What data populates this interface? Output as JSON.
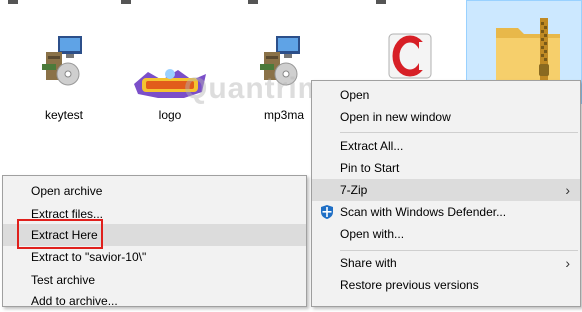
{
  "files": [
    {
      "label": "keytest",
      "icon": "installer-icon"
    },
    {
      "label": "logo",
      "icon": "everwing-logo-icon"
    },
    {
      "label": "mp3ma",
      "icon": "installer-icon"
    },
    {
      "label": "",
      "icon": "opera-icon"
    },
    {
      "label": "",
      "icon": "zip-folder-icon"
    }
  ],
  "watermark": "Quantrimang",
  "context_menu": {
    "items": [
      {
        "label": "Open"
      },
      {
        "label": "Open in new window"
      },
      {
        "label": "Extract All..."
      },
      {
        "label": "Pin to Start"
      },
      {
        "label": "7-Zip"
      },
      {
        "label": "Scan with Windows Defender..."
      },
      {
        "label": "Open with..."
      },
      {
        "label": "Share with"
      },
      {
        "label": "Restore previous versions"
      }
    ],
    "submenu_arrow": "›"
  },
  "zip_submenu": {
    "items": [
      {
        "label": "Open archive"
      },
      {
        "label": "Extract files..."
      },
      {
        "label": "Extract Here"
      },
      {
        "label": "Extract to \"savior-10\\\""
      },
      {
        "label": "Test archive"
      },
      {
        "label": "Add to archive..."
      }
    ]
  },
  "colors": {
    "highlight_box": "#e0201c",
    "selection": "#cce8ff",
    "menu_bg": "#f2f2f2"
  }
}
